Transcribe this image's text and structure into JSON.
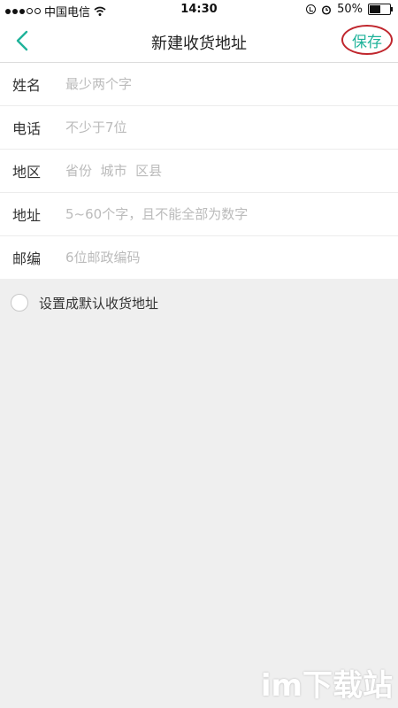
{
  "status_bar": {
    "carrier": "中国电信",
    "time": "14:30",
    "battery": "50%",
    "battery_level": 0.5
  },
  "nav": {
    "title": "新建收货地址",
    "save_label": "保存"
  },
  "form": {
    "rows": [
      {
        "label": "姓名",
        "placeholder": "最少两个字"
      },
      {
        "label": "电话",
        "placeholder": "不少于7位"
      },
      {
        "label": "地区",
        "placeholder": "省份  城市  区县"
      },
      {
        "label": "地址",
        "placeholder": "5~60个字，且不能全部为数字"
      },
      {
        "label": "邮编",
        "placeholder": "6位邮政编码"
      }
    ]
  },
  "default_option": {
    "label": "设置成默认收货地址",
    "checked": false
  },
  "watermark": "im下载站",
  "colors": {
    "accent": "#1fb39a",
    "annotation_circle": "#c0262d",
    "background": "#efefef"
  }
}
